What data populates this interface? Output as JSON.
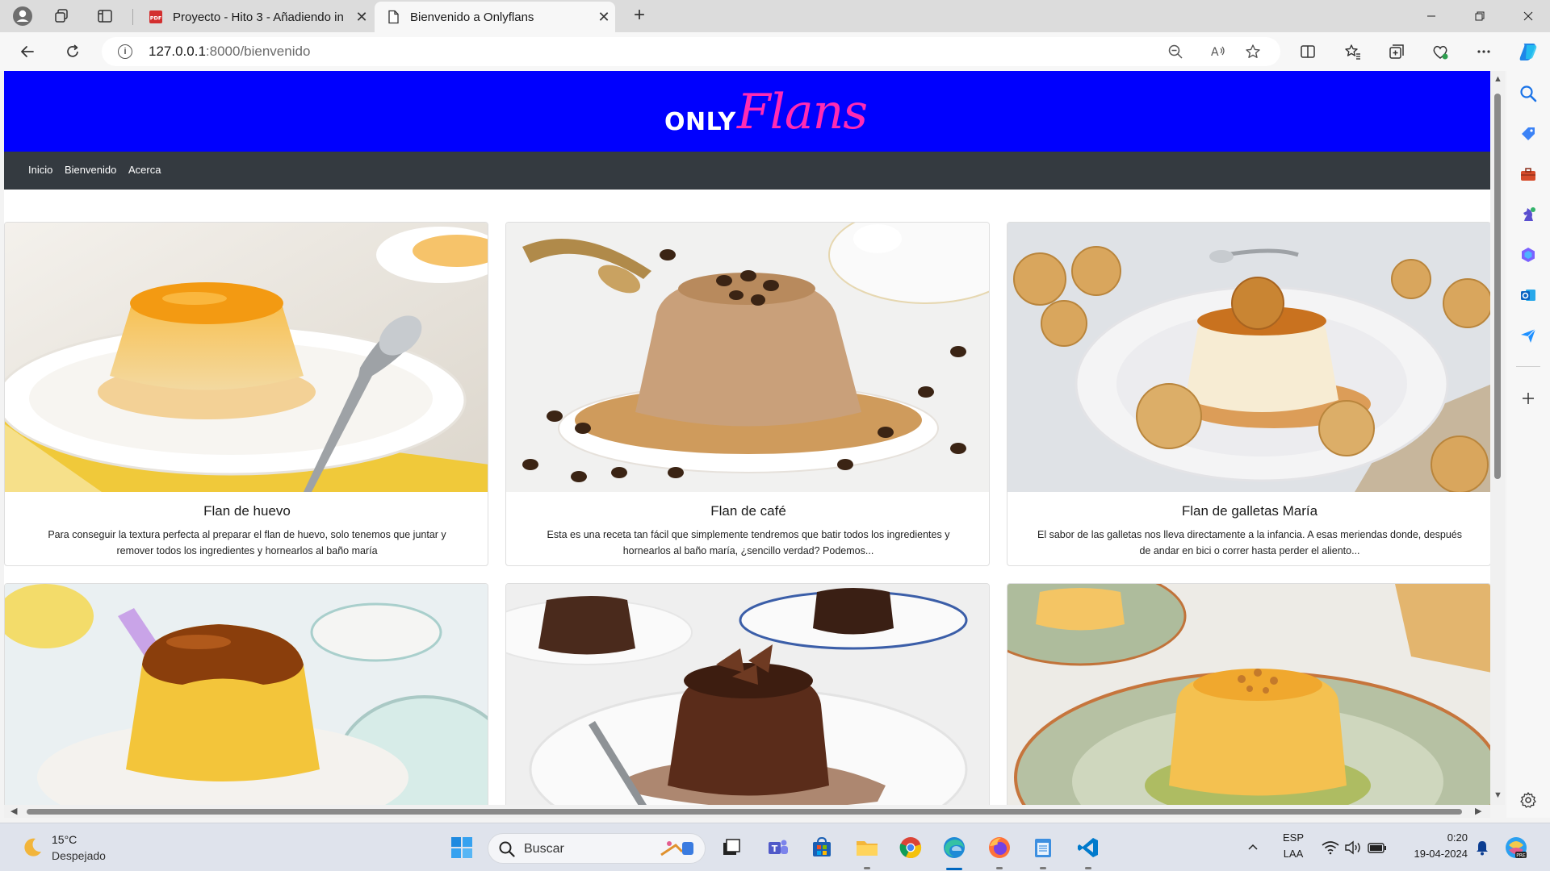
{
  "browser": {
    "tabs": [
      {
        "title": "Proyecto - Hito 3 - Añadiendo in",
        "favicon": "pdf-icon",
        "active": false
      },
      {
        "title": "Bienvenido a Onlyflans",
        "favicon": "page-icon",
        "active": true
      }
    ],
    "url_host": "127.0.0.1",
    "url_rest": ":8000/bienvenido"
  },
  "site": {
    "logo_only": "ONLY",
    "logo_flans": "Flans",
    "brand_color": "#0000fe",
    "logo_accent_color": "#ff2bb3",
    "nav": [
      "Inicio",
      "Bienvenido",
      "Acerca"
    ]
  },
  "cards": [
    {
      "title": "Flan de huevo",
      "text": "Para conseguir la textura perfecta al preparar el flan de huevo, solo tenemos que juntar y remover todos los ingredientes y hornearlos al baño maría"
    },
    {
      "title": "Flan de café",
      "text": "Esta es una receta tan fácil que simplemente tendremos que batir todos los ingredientes y hornearlos al baño maría, ¿sencillo verdad? Podemos..."
    },
    {
      "title": "Flan de galletas María",
      "text": "El sabor de las galletas nos lleva directamente a la infancia. A esas meriendas donde, después de andar en bici o correr hasta perder el aliento..."
    },
    {
      "title": "",
      "text": ""
    },
    {
      "title": "",
      "text": ""
    },
    {
      "title": "",
      "text": ""
    }
  ],
  "taskbar": {
    "weather_temp": "15°C",
    "weather_desc": "Despejado",
    "search_placeholder": "Buscar",
    "lang": "ESP",
    "layout": "LAA",
    "time": "0:20",
    "date": "19-04-2024"
  }
}
